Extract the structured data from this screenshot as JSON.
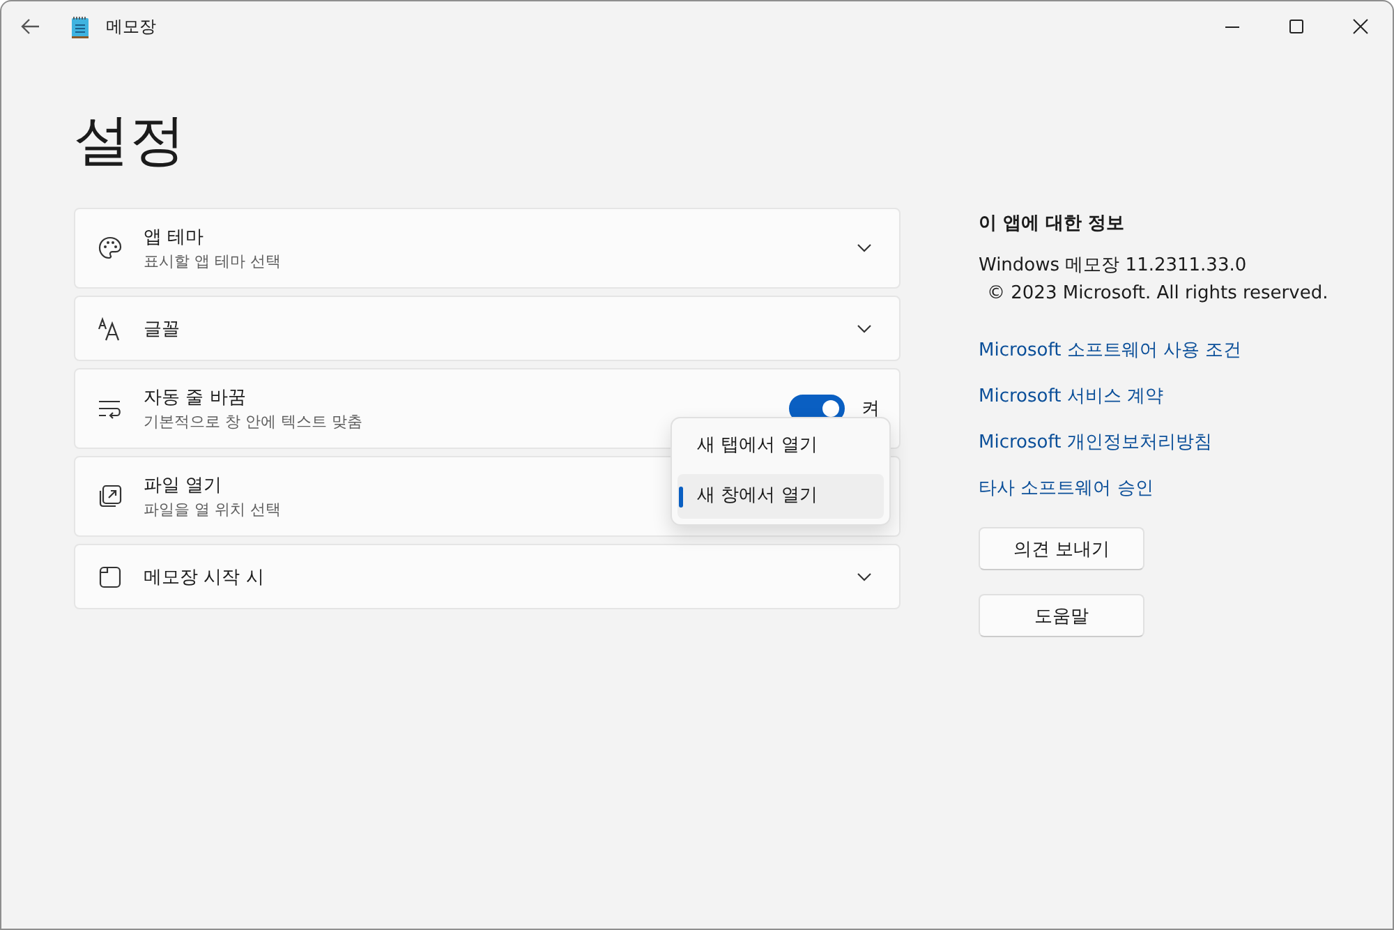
{
  "window": {
    "title": "메모장"
  },
  "page_title": "설정",
  "settings": [
    {
      "kind": "expander",
      "title": "앱 테마",
      "subtitle": "표시할 앱 테마 선택"
    },
    {
      "kind": "expander",
      "title": "글꼴"
    },
    {
      "kind": "toggle",
      "title": "자동 줄 바꿈",
      "subtitle": "기본적으로 창 안에 텍스트 맞춤",
      "on": true,
      "state_label": "켜"
    },
    {
      "kind": "menu",
      "title": "파일 열기",
      "subtitle": "파일을 열 위치 선택",
      "expanded": true,
      "options": [
        {
          "label": "새 탭에서 열기",
          "selected": false
        },
        {
          "label": "새 창에서 열기",
          "selected": true
        }
      ]
    },
    {
      "kind": "expander",
      "title": "메모장 시작 시"
    }
  ],
  "about": {
    "heading": "이 앱에 대한 정보",
    "version": "Windows 메모장 11.2311.33.0",
    "copyright": "© 2023 Microsoft. All rights reserved.",
    "links": [
      "Microsoft 소프트웨어 사용 조건",
      "Microsoft 서비스 계약",
      "Microsoft 개인정보처리방침",
      "타사 소프트웨어 승인"
    ],
    "buttons": [
      "의견 보내기",
      "도움말"
    ]
  }
}
